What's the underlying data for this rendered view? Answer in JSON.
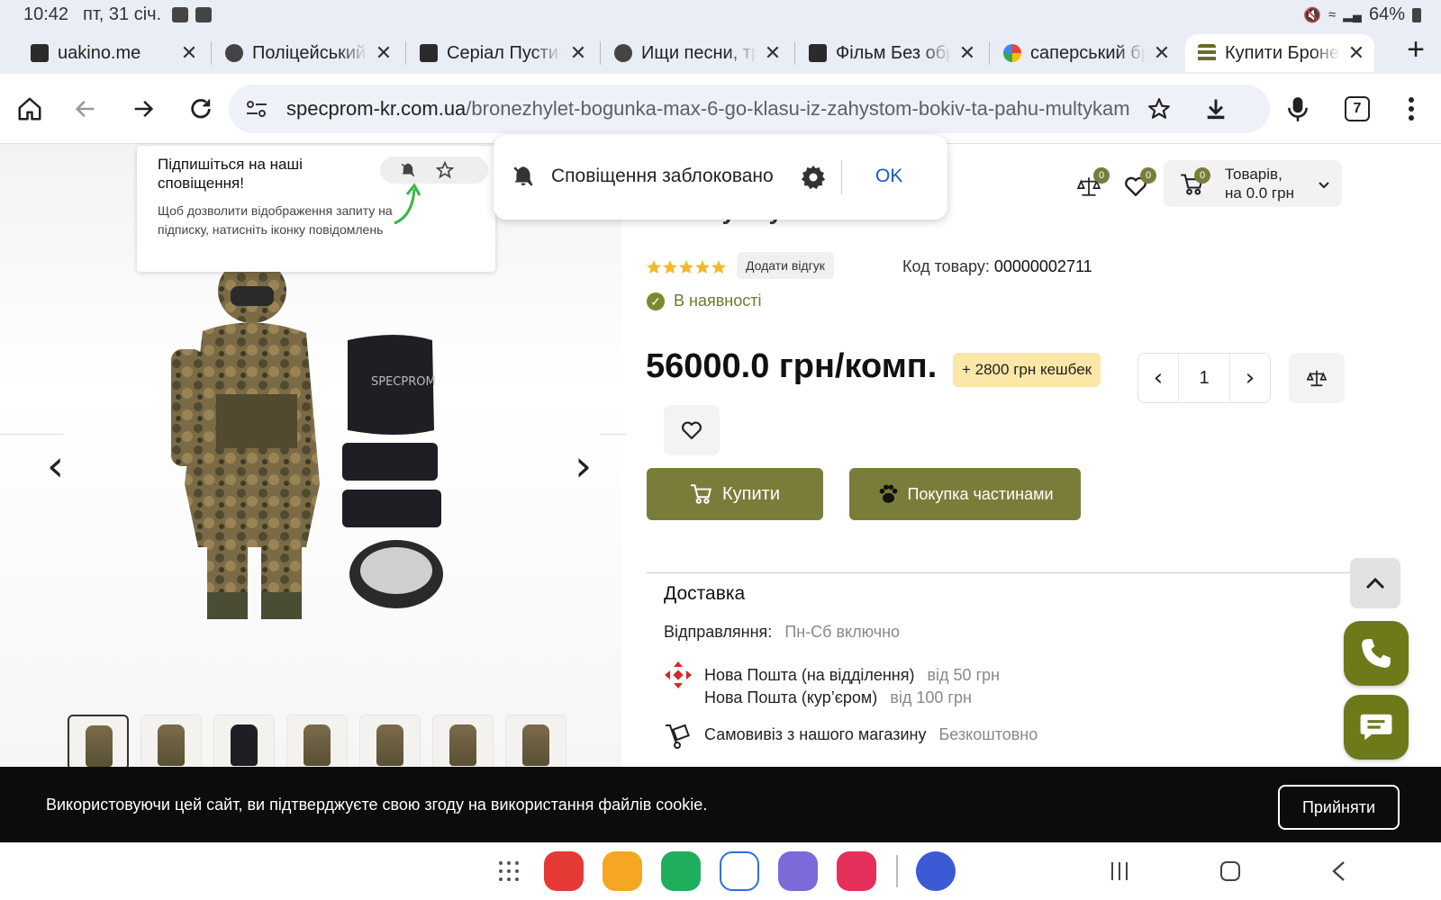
{
  "status_bar": {
    "time": "10:42",
    "date": "пт, 31 січ.",
    "battery": "64%"
  },
  "tabs": [
    {
      "title": "uakino.me",
      "favicon": "clapper-icon",
      "active": false
    },
    {
      "title": "Поліцейський з",
      "favicon": "globe-icon",
      "active": false
    },
    {
      "title": "Серіал Пустити",
      "favicon": "clapper-icon",
      "active": false
    },
    {
      "title": "Ищи песни, тре",
      "favicon": "globe-icon",
      "active": false
    },
    {
      "title": "Фільм Без обра",
      "favicon": "clapper-icon",
      "active": false
    },
    {
      "title": "саперський бро",
      "favicon": "google-icon",
      "active": false
    },
    {
      "title": "Купити Бронеж",
      "favicon": "store-icon",
      "active": true
    }
  ],
  "toolbar": {
    "url_domain": "specprom-kr.com.ua",
    "url_path": "/bronezhylet-bogunka-max-6-go-klasu-iz-zahystom-bokiv-ta-pahu-multykam",
    "tab_count": "7"
  },
  "subscribe_popup": {
    "heading": "Підпишіться на наші сповіщення!",
    "body": "Щоб дозволити відображення запиту на підписку, натисніть іконку повідомлень"
  },
  "blocked_popup": {
    "text": "Сповіщення заблоковано",
    "ok_label": "OK"
  },
  "header": {
    "compare_count": "0",
    "wishlist_count": "0",
    "cart_count": "0",
    "cart_line1": "Товарів,",
    "cart_line2": "на 0.0 грн"
  },
  "product": {
    "title_fragment": "та паху. Мультикам.",
    "rating_stars": 5,
    "review_button": "Додати відгук",
    "code_label": "Код товару:",
    "code_value": "00000002711",
    "availability": "В наявності",
    "price": "56000.0 грн/комп.",
    "cashback": "+ 2800 грн кешбек",
    "quantity": "1",
    "buy_label": "Купити",
    "parts_label": "Покупка частинами"
  },
  "delivery": {
    "title": "Доставка",
    "ship_label": "Відправляння:",
    "ship_value": "Пн-Сб включно",
    "np_branch": "Нова Пошта (на відділення)",
    "np_branch_price": "від 50 грн",
    "np_courier": "Нова Пошта (кур’єром)",
    "np_courier_price": "від 100 грн",
    "pickup": "Самовивіз з нашого магазину",
    "pickup_price": "Безкоштовно"
  },
  "cookie": {
    "message": "Використовуючи цей сайт, ви підтверджуєте свою згоду на використання файлів cookie.",
    "accept_label": "Прийняти"
  },
  "colors": {
    "brand_olive": "#7a7d3a",
    "fab_green": "#6e7a1a",
    "link_blue": "#1a57c8",
    "cashback_bg": "#fbe7a7"
  }
}
